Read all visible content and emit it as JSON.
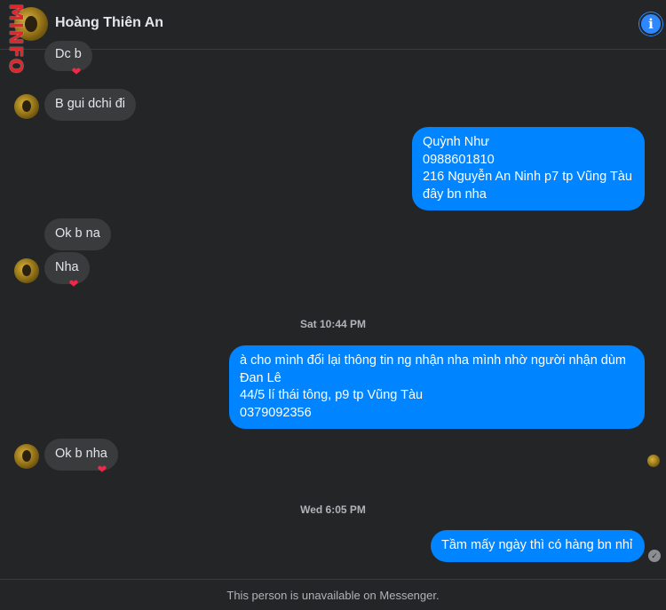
{
  "header": {
    "contact_name": "Hoàng Thiên An",
    "watermark": "MINFO",
    "info_icon": "info-icon",
    "info_glyph": "i"
  },
  "messages": [
    {
      "from": "them",
      "text": "Dc b",
      "reaction": "❤"
    },
    {
      "from": "them",
      "text": "B gui dchi đi"
    },
    {
      "from": "me",
      "text": "Quỳnh Như\n0988601810\n216 Nguyễn An Ninh p7 tp Vũng Tàu\nđây bn nha"
    },
    {
      "from": "them",
      "text": "Ok b na"
    },
    {
      "from": "them",
      "text": "Nha",
      "reaction": "❤"
    },
    {
      "from": "me",
      "text": "à cho mình đổi lại thông tin ng nhận nha mình nhờ người nhận dùm\nĐan Lê\n44/5 lí thái tông, p9 tp Vũng Tàu\n0379092356"
    },
    {
      "from": "them",
      "text": "Ok b nha",
      "reaction": "❤"
    },
    {
      "from": "me",
      "text": "Tầm mấy ngày thì có hàng bn nhỉ"
    }
  ],
  "timestamps": [
    "Sat 10:44 PM",
    "Wed 6:05 PM"
  ],
  "sent_check_glyph": "✓",
  "footer": {
    "text": "This person is unavailable on Messenger."
  },
  "colors": {
    "background": "#242526",
    "incoming": "#3a3b3c",
    "outgoing": "#0084ff",
    "accent": "#2d88ff"
  }
}
